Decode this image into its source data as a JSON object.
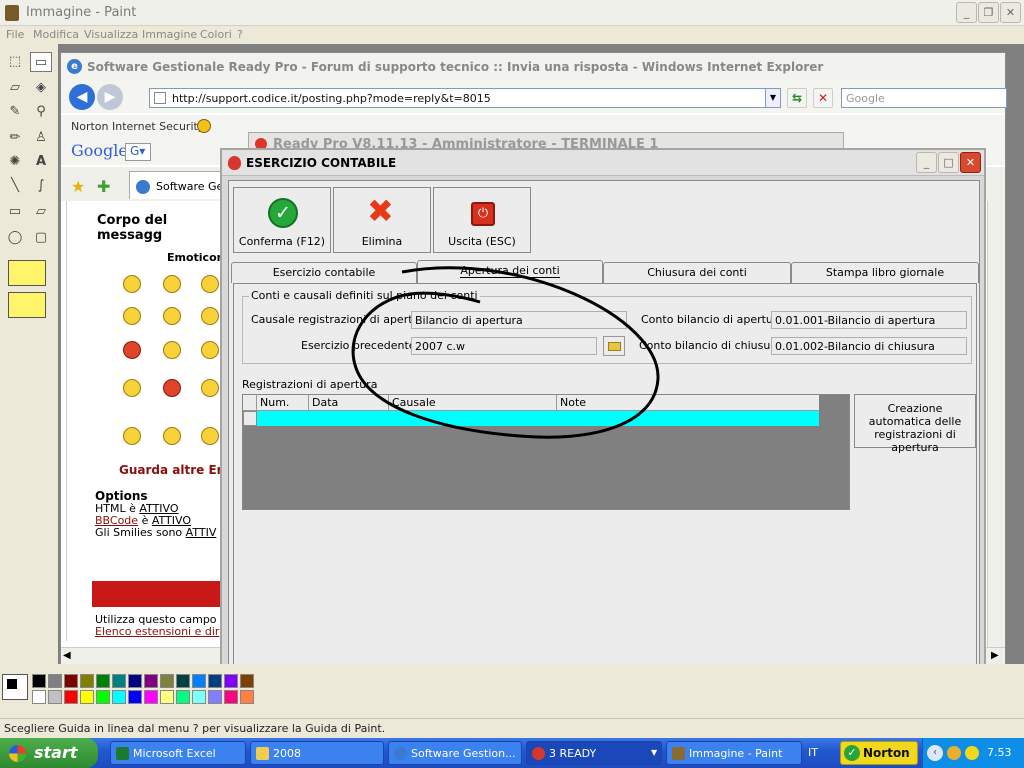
{
  "paint": {
    "title": "Immagine - Paint",
    "menu": [
      "File",
      "Modifica",
      "Visualizza",
      "Immagine",
      "Colori",
      "?"
    ],
    "status": "Scegliere Guida in linea dal menu ? per visualizzare la Guida di Paint.",
    "palette": [
      "#000000",
      "#808080",
      "#800000",
      "#808000",
      "#008000",
      "#008080",
      "#000080",
      "#800080",
      "#808040",
      "#004040",
      "#0080ff",
      "#004080",
      "#8000ff",
      "#804000",
      "#ffffff",
      "#c0c0c0",
      "#ff0000",
      "#ffff00",
      "#00ff00",
      "#00ffff",
      "#0000ff",
      "#ff00ff",
      "#ffff80",
      "#00ff80",
      "#80ffff",
      "#8080ff",
      "#ff0080",
      "#ff8040"
    ]
  },
  "ie": {
    "title": "Software Gestionale Ready Pro - Forum di supporto tecnico :: Invia una risposta - Windows Internet Explorer",
    "address": "http://support.codice.it/posting.php?mode=reply&t=8015",
    "search_placeholder": "Google",
    "norton_toolbar": "Norton Internet Security",
    "google_label": "Google",
    "tab_label": "Software Gest",
    "page": {
      "heading": "Corpo del messagg",
      "emoticons": "Emoticons",
      "guarda": "Guarda altre Em",
      "options_title": "Options",
      "html_label": "HTML è",
      "html_state": "ATTIVO",
      "bbcode_label": "BBCode",
      "bbcode_mid": "è",
      "bbcode_state": "ATTIVO",
      "smilies": "Gli Smilies sono",
      "smilies_state": "ATTIV",
      "utilizza": "Utilizza questo campo",
      "elenco": "Elenco estensioni e dir"
    }
  },
  "readypro": {
    "title": "Ready Pro V8.11.13 - Amministratore - TERMINALE 1"
  },
  "dialog": {
    "title": "ESERCIZIO CONTABILE",
    "buttons": {
      "confirm": "Conferma (F12)",
      "delete": "Elimina",
      "exit": "Uscita (ESC)"
    },
    "tabs": [
      "Esercizio contabile",
      "Apertura dei conti",
      "Chiusura dei conti",
      "Stampa libro giornale"
    ],
    "group_title": "Conti e causali definiti sul piano dei conti",
    "fields": {
      "causale_label": "Causale registrazioni di apertura :",
      "causale_value": "Bilancio di apertura",
      "esercizio_label": "Esercizio precedente :",
      "esercizio_value": "2007 c.w",
      "conto_ap_label": "Conto bilancio di apertura :",
      "conto_ap_value": "0.01.001-Bilancio di apertura",
      "conto_ch_label": "Conto bilancio di chiusura :",
      "conto_ch_value": "0.01.002-Bilancio di chiusura"
    },
    "registrazioni_label": "Registrazioni di apertura",
    "grid_columns": [
      "Num.",
      "Data",
      "Causale",
      "Note"
    ],
    "auto_button": "Creazione automatica delle registrazioni di apertura"
  },
  "taskbar": {
    "start": "start",
    "items": [
      "Microsoft Excel",
      "2008",
      "Software Gestion...",
      "3 READY",
      "Immagine - Paint"
    ],
    "lang": "IT",
    "norton": "Norton",
    "clock": "7.53"
  },
  "colors": {
    "grid_row": "#00ffff",
    "taskbar": "#245edb",
    "annotation_stroke": "#000000"
  }
}
